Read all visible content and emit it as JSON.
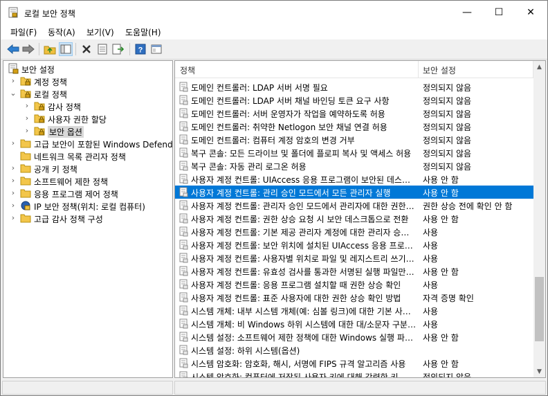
{
  "window": {
    "title": "로컬 보안 정책",
    "minimize_glyph": "—",
    "maximize_glyph": "☐",
    "close_glyph": "✕"
  },
  "menu": [
    "파일(F)",
    "동작(A)",
    "보기(V)",
    "도움말(H)"
  ],
  "toolbar": {
    "icons": [
      "back-icon",
      "forward-icon",
      "up-folder-icon",
      "show-hide-tree-icon",
      "delete-icon",
      "properties-icon",
      "export-list-icon",
      "help-icon",
      "console-view-icon"
    ]
  },
  "tree": [
    {
      "label": "보안 설정",
      "level": 0,
      "expander": "",
      "icon": "security-settings-icon"
    },
    {
      "label": "계정 정책",
      "level": 1,
      "expander": "›",
      "icon": "folder-lock-icon"
    },
    {
      "label": "로컬 정책",
      "level": 1,
      "expander": "⌄",
      "icon": "folder-lock-icon"
    },
    {
      "label": "감사 정책",
      "level": 2,
      "expander": "›",
      "icon": "folder-lock-icon"
    },
    {
      "label": "사용자 권한 할당",
      "level": 2,
      "expander": "›",
      "icon": "folder-lock-icon"
    },
    {
      "label": "보안 옵션",
      "level": 2,
      "expander": "›",
      "icon": "folder-lock-icon",
      "selected": true
    },
    {
      "label": "고급 보안이 포함된 Windows Defender",
      "level": 1,
      "expander": "›",
      "icon": "folder-icon"
    },
    {
      "label": "네트워크 목록 관리자 정책",
      "level": 1,
      "expander": "",
      "icon": "folder-icon"
    },
    {
      "label": "공개 키 정책",
      "level": 1,
      "expander": "›",
      "icon": "folder-icon"
    },
    {
      "label": "소프트웨어 제한 정책",
      "level": 1,
      "expander": "›",
      "icon": "folder-icon"
    },
    {
      "label": "응용 프로그램 제어 정책",
      "level": 1,
      "expander": "›",
      "icon": "folder-icon"
    },
    {
      "label": "IP 보안 정책(위치: 로컬 컴퓨터)",
      "level": 1,
      "expander": "›",
      "icon": "ip-security-icon"
    },
    {
      "label": "고급 감사 정책 구성",
      "level": 1,
      "expander": "›",
      "icon": "folder-icon"
    }
  ],
  "columns": {
    "policy": "정책",
    "setting": "보안 설정"
  },
  "rows": [
    {
      "policy": "도메인 컨트롤러: LDAP 서버 서명 필요",
      "setting": "정의되지 않음"
    },
    {
      "policy": "도메인 컨트롤러: LDAP 서버 채널 바인딩 토큰 요구 사항",
      "setting": "정의되지 않음"
    },
    {
      "policy": "도메인 컨트롤러: 서버 운영자가 작업을 예약하도록 허용",
      "setting": "정의되지 않음"
    },
    {
      "policy": "도메인 컨트롤러: 취약한 Netlogon 보안 채널 연결 허용",
      "setting": "정의되지 않음"
    },
    {
      "policy": "도메인 컨트롤러: 컴퓨터 계정 암호의 변경 거부",
      "setting": "정의되지 않음"
    },
    {
      "policy": "복구 콘솔: 모든 드라이브 및 폴더에 플로피 복사 및 액세스 허용",
      "setting": "정의되지 않음"
    },
    {
      "policy": "복구 콘솔: 자동 관리 로그온 허용",
      "setting": "정의되지 않음"
    },
    {
      "policy": "사용자 계정 컨트롤: UIAccess 응용 프로그램이 보안된 데스크톱을 사용하지 않고 권한 상승 확인",
      "setting": "사용 안 함"
    },
    {
      "policy": "사용자 계정 컨트롤: 관리 승인 모드에서 모든 관리자 실행",
      "setting": "사용 안 함",
      "selected": true
    },
    {
      "policy": "사용자 계정 컨트롤: 관리자 승인 모드에서 관리자에 대한 권한 상승 확인 방법",
      "setting": "권한 상승 전에 확인 안 함"
    },
    {
      "policy": "사용자 계정 컨트롤: 권한 상승 요청 시 보안 데스크톱으로 전환",
      "setting": "사용 안 함"
    },
    {
      "policy": "사용자 계정 컨트롤: 기본 제공 관리자 계정에 대한 관리자 승인 모드",
      "setting": "사용"
    },
    {
      "policy": "사용자 계정 컨트롤: 보안 위치에 설치된 UIAccess 응용 프로그램만 권한 상승",
      "setting": "사용"
    },
    {
      "policy": "사용자 계정 컨트롤: 사용자별 위치로 파일 및 레지스트리 쓰기 오류 가상화",
      "setting": "사용"
    },
    {
      "policy": "사용자 계정 컨트롤: 유효성 검사를 통과한 서명된 실행 파일만 권한 상승",
      "setting": "사용 안 함"
    },
    {
      "policy": "사용자 계정 컨트롤: 응용 프로그램 설치할 때 권한 상승 확인",
      "setting": "사용"
    },
    {
      "policy": "사용자 계정 컨트롤: 표준 사용자에 대한 권한 상승 확인 방법",
      "setting": "자격 증명 확인"
    },
    {
      "policy": "시스템 개체: 내부 시스템 개체(예: 심볼 링크)에 대한 기본 사용 권한 강화",
      "setting": "사용"
    },
    {
      "policy": "시스템 개체: 비 Windows 하위 시스템에 대한 대/소문자 구분 안 함",
      "setting": "사용"
    },
    {
      "policy": "시스템 설정: 소프트웨어 제한 정책에 대한 Windows 실행 파일의 인증서 규칙 사용",
      "setting": "사용 안 함"
    },
    {
      "policy": "시스템 설정: 하위 시스템(옵션)",
      "setting": ""
    },
    {
      "policy": "시스템 암호화: 암호화, 해시, 서명에 FIPS 규격 알고리즘 사용",
      "setting": "사용 안 함"
    },
    {
      "policy": "시스템 암호화: 컴퓨터에 저장된 사용자 키에 대해 강력한 키 보호 사용",
      "setting": "정의되지 않음"
    }
  ],
  "colors": {
    "selection": "#0078d7",
    "folder": "#f0c040",
    "lock": "#d4a017"
  }
}
